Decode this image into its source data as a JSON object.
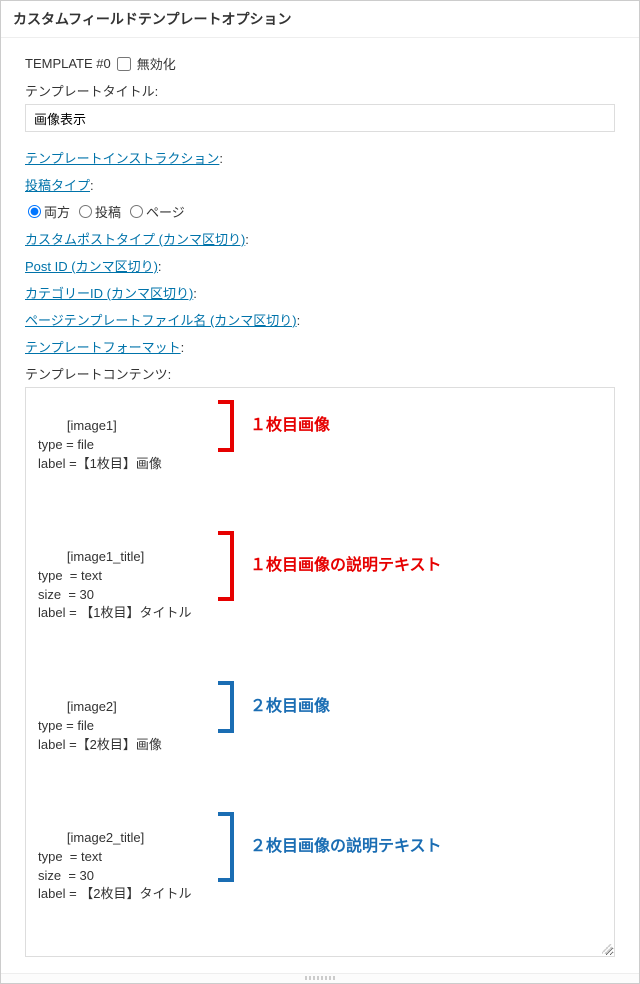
{
  "header": {
    "title": "カスタムフィールドテンプレートオプション"
  },
  "template": {
    "name_label": "TEMPLATE #0",
    "disable_label": "無効化"
  },
  "title_field": {
    "label": "テンプレートタイトル:",
    "value": "画像表示"
  },
  "links": {
    "instruction": "テンプレートインストラクション",
    "post_type": "投稿タイプ",
    "custom_post_type": "カスタムポストタイプ (カンマ区切り)",
    "post_id": "Post ID (カンマ区切り)",
    "category_id": "カテゴリーID (カンマ区切り)",
    "page_template": "ページテンプレートファイル名 (カンマ区切り)",
    "template_format": "テンプレートフォーマット"
  },
  "colon": ":",
  "post_type_options": {
    "both": "両方",
    "post": "投稿",
    "page": "ページ"
  },
  "content": {
    "label": "テンプレートコンテンツ:",
    "blocks": [
      "[image1]\ntype = file\nlabel =【1枚目】画像",
      "[image1_title]\ntype  = text\nsize  = 30\nlabel = 【1枚目】タイトル",
      "[image2]\ntype = file\nlabel =【2枚目】画像",
      "[image2_title]\ntype  = text\nsize  = 30\nlabel = 【2枚目】タイトル"
    ]
  },
  "annotations": {
    "img1": "１枚目画像",
    "img1_text": "１枚目画像の説明テキスト",
    "img2": "２枚目画像",
    "img2_text": "２枚目画像の説明テキスト"
  }
}
